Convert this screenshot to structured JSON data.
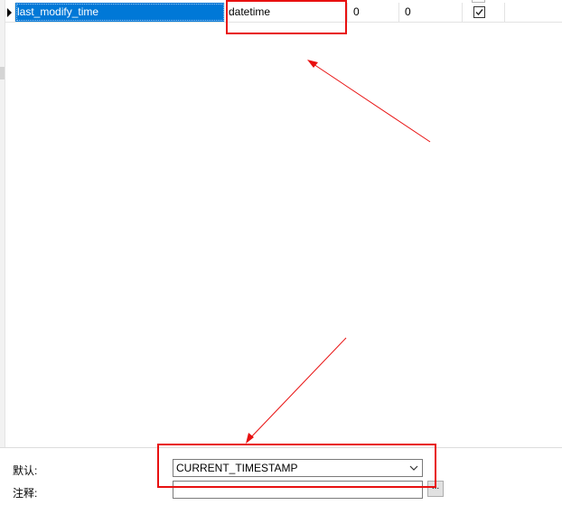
{
  "field_row": {
    "name": "last_modify_time",
    "type": "datetime",
    "length": "0",
    "decimals": "0",
    "not_null_checked": true
  },
  "properties": {
    "default_label": "默认:",
    "default_value": "CURRENT_TIMESTAMP",
    "comment_label": "注释:",
    "comment_value": "",
    "ellipsis_label": "..."
  },
  "icons": {
    "row_indicator": "row-pointer-icon",
    "dropdown": "chevron-down-icon",
    "checkbox": "checkbox-checked-icon"
  },
  "colors": {
    "selection": "#0078d7",
    "annotation": "#e81010"
  }
}
